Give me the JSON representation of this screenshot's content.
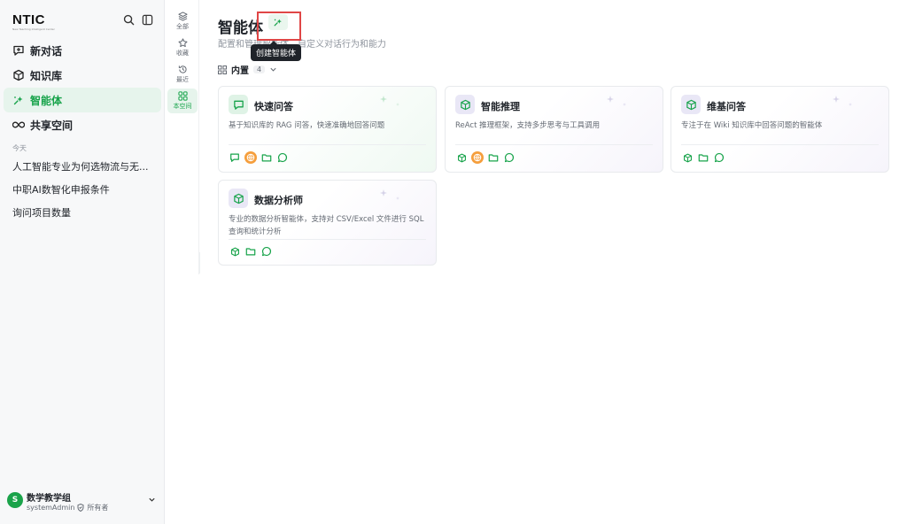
{
  "sidebar": {
    "logo": "NTIC",
    "logo_sub": "New Teaching Intelligent Center",
    "nav": [
      {
        "label": "新对话",
        "icon": "new-chat-icon"
      },
      {
        "label": "知识库",
        "icon": "knowledge-base-icon"
      },
      {
        "label": "智能体",
        "icon": "agent-sparkle-icon",
        "active": true
      },
      {
        "label": "共享空间",
        "icon": "infinity-icon"
      }
    ],
    "section_today": "今天",
    "history": [
      "人工智能专业为何选物流与无...",
      "中职AI数智化申报条件",
      "询问项目数量"
    ],
    "user": {
      "avatar": "S",
      "name": "数学教学组",
      "account": "systemAdmin",
      "role": "所有者"
    }
  },
  "filters": [
    {
      "label": "全部",
      "icon": "layers-icon"
    },
    {
      "label": "收藏",
      "icon": "star-icon"
    },
    {
      "label": "最近",
      "icon": "history-icon"
    },
    {
      "label": "本空间",
      "icon": "space-icon",
      "active": true
    }
  ],
  "main": {
    "title": "智能体",
    "subtitle": "配置和管理智能体，自定义对话行为和能力",
    "tooltip": "创建智能体",
    "builtin_label": "内置",
    "builtin_count": "4"
  },
  "cards": [
    {
      "title": "快速问答",
      "desc": "基于知识库的 RAG 问答，快速准确地回答问题",
      "icon": "chat-icon",
      "tags": [
        "chat-tag-icon",
        "web-search-tag-icon",
        "folder-tag-icon",
        "message-tag-icon"
      ]
    },
    {
      "title": "智能推理",
      "desc": "ReAct 推理框架，支持多步思考与工具调用",
      "icon": "cube-icon",
      "tags": [
        "cube-tag-icon",
        "web-search-tag-icon",
        "folder-tag-icon",
        "message-tag-icon"
      ]
    },
    {
      "title": "维基问答",
      "desc": "专注于在 Wiki 知识库中回答问题的智能体",
      "icon": "cube-icon",
      "tags": [
        "cube-tag-icon",
        "folder-tag-icon",
        "message-tag-icon"
      ]
    },
    {
      "title": "数据分析师",
      "desc": "专业的数据分析智能体，支持对 CSV/Excel 文件进行 SQL 查询和统计分析",
      "icon": "cube-icon",
      "tags": [
        "cube-tag-icon",
        "folder-tag-icon",
        "message-tag-icon"
      ]
    }
  ],
  "colors": {
    "accent": "#17a34a",
    "highlight": "#e04646"
  }
}
